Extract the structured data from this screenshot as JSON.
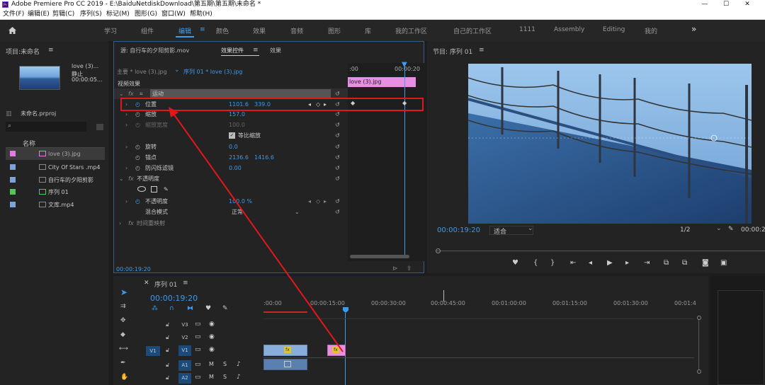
{
  "window": {
    "title": "Adobe Premiere Pro CC 2019 - E:\\BaiduNetdiskDownload\\第五期\\第五期\\未命名 *",
    "app_logo": "Pr",
    "controls": {
      "minimize": "—",
      "maximize": "☐",
      "close": "✕"
    }
  },
  "menu": [
    "文件(F)",
    "编辑(E)",
    "剪辑(C)",
    "序列(S)",
    "标记(M)",
    "图形(G)",
    "窗口(W)",
    "帮助(H)"
  ],
  "workspaces": {
    "items": [
      "学习",
      "组件",
      "编辑",
      "颜色",
      "效果",
      "音频",
      "图形",
      "库",
      "我的工作区",
      "自己的工作区",
      "1111",
      "Assembly",
      "Editing",
      "我的"
    ],
    "active": "编辑",
    "more": "»"
  },
  "project": {
    "title": "项目:未命名",
    "menu_icon": "≡",
    "clip_name": "love (3)...",
    "clip_type": "静止",
    "clip_dur": "00:00:05...",
    "proj_file": "未命名.prproj",
    "search_placeholder": "",
    "col_name": "名称",
    "items": [
      {
        "name": "love (3).jpg",
        "color": "#e37ce0"
      },
      {
        "name": "City Of Stars .mp4",
        "color": "#7ea3d9"
      },
      {
        "name": "自行车的夕阳剪影",
        "color": "#7ea3d9"
      },
      {
        "name": "序列 01",
        "color": "#55c45c"
      },
      {
        "name": "文库.mp4",
        "color": "#7ea3d9"
      }
    ]
  },
  "effects": {
    "tab_source": "源: 自行车的夕阳剪影.mov",
    "tab_fx": "效果控件",
    "tab_fx_menu": "≡",
    "tab_effects": "效果",
    "master": "主要 * love (3).jpg",
    "seq": "序列 01 * love (3).jpg",
    "video_effects": "视频效果",
    "tc_start": ":00",
    "tc_end": "00:00:20",
    "clip_label": "love (3).jpg",
    "motion": "运动",
    "position": "位置",
    "pos_x": "1101.6",
    "pos_y": "339.0",
    "scale": "缩放",
    "scale_val": "157.0",
    "scale_w": "缩放宽度",
    "scale_w_val": "100.0",
    "uniform": "等比缩放",
    "rotation": "旋转",
    "rotation_val": "0.0",
    "anchor": "锚点",
    "anchor_x": "2136.6",
    "anchor_y": "1416.6",
    "antiflicker": "防闪烁滤镜",
    "antiflicker_val": "0.00",
    "opacity_grp": "不透明度",
    "opacity": "不透明度",
    "opacity_val": "100.0 %",
    "blend": "混合模式",
    "blend_val": "正常",
    "time_remap": "时间重映射",
    "footer_tc": "00:00:19:20",
    "fx_label": "fx"
  },
  "program": {
    "title": "节目: 序列 01",
    "menu_icon": "≡",
    "timecode": "00:00:19:20",
    "fit": "适合",
    "quality": "1/2",
    "tc_right": "00:00:2"
  },
  "timeline": {
    "title": "序列 01",
    "menu_icon": "≡",
    "timecode": "00:00:19:20",
    "ruler": [
      ":00:00",
      "00:00:15:00",
      "00:00:30:00",
      "00:00:45:00",
      "00:01:00:00",
      "00:01:15:00",
      "00:01:30:00",
      "00:01:4"
    ],
    "tracks": [
      {
        "name": "V3",
        "src": ""
      },
      {
        "name": "V2",
        "src": ""
      },
      {
        "name": "V1",
        "src": "V1"
      },
      {
        "name": "A1",
        "src": ""
      },
      {
        "name": "A2",
        "src": ""
      }
    ],
    "mute": "M",
    "solo": "S",
    "fx_badge": "fx"
  },
  "colors": {
    "accent": "#3a9bf0",
    "annotation": "#e0181e",
    "clip_pink": "#e88fe4",
    "clip_blue": "#8aaedc",
    "panel": "#232323"
  }
}
